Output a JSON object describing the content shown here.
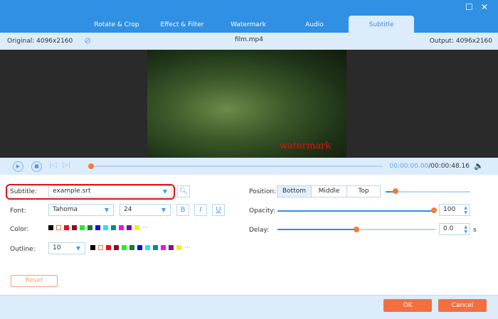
{
  "window": {
    "maximize_icon": "square-icon",
    "close_icon": "x-icon"
  },
  "tabs": [
    {
      "label": "Rotate & Crop"
    },
    {
      "label": "Effect & Filter"
    },
    {
      "label": "Watermark"
    },
    {
      "label": "Audio"
    },
    {
      "label": "Subtitle",
      "active": true
    }
  ],
  "info": {
    "original": "Original: 4096x2160",
    "filename": "film.mp4",
    "output": "Output: 4096x2160"
  },
  "video": {
    "watermark_text": "watermark"
  },
  "playback": {
    "current": "00:00:00.00",
    "total": "/00:00:48.16",
    "progress": 0
  },
  "subtitle": {
    "label": "Subtitle:",
    "file": "example.srt"
  },
  "font": {
    "label": "Font:",
    "family": "Tahoma",
    "size": "24",
    "bold": "B",
    "italic": "I",
    "underline": "U"
  },
  "color": {
    "label": "Color:",
    "more": "···"
  },
  "outline": {
    "label": "Outline:",
    "value": "10",
    "more": "···"
  },
  "swatches": [
    "#000000",
    "#ffffff",
    "#e8101a",
    "#8b1020",
    "#22ee22",
    "#108030",
    "#0a10f0",
    "#20e8f0",
    "#108890",
    "#f010f0",
    "#801090",
    "#f0f020"
  ],
  "position": {
    "label": "Position:",
    "options": [
      "Bottom",
      "Middle",
      "Top"
    ],
    "selected": "Bottom",
    "slider": 0.1
  },
  "opacity": {
    "label": "Opacity:",
    "value": "100"
  },
  "delay": {
    "label": "Delay:",
    "value": "0.0",
    "unit": "s",
    "slider": 0.5
  },
  "buttons": {
    "reset": "Reset",
    "ok": "OK",
    "cancel": "Cancel"
  },
  "colors": {
    "accent": "#2f90e4",
    "orange": "#f36f3f",
    "highlight": "#e0101a"
  }
}
